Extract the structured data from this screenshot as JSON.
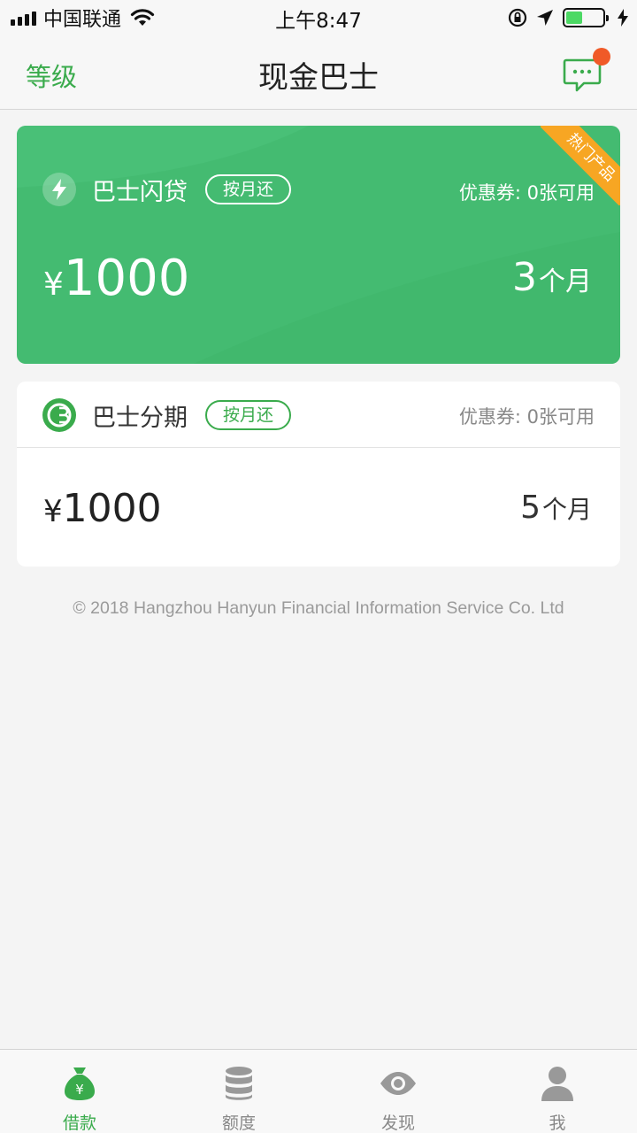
{
  "status_bar": {
    "carrier": "中国联通",
    "time": "上午8:47",
    "battery_level": 0.45
  },
  "nav": {
    "left_label": "等级",
    "title": "现金巴士",
    "message_icon": "chat-bubble-icon",
    "has_unread": true
  },
  "products": [
    {
      "name": "巴士闪贷",
      "icon": "lightning-icon",
      "tag": "按月还",
      "coupon": "优惠券: 0张可用",
      "currency": "¥",
      "amount": "1000",
      "term_value": "3",
      "term_unit": "个月",
      "badge": "热门产品"
    },
    {
      "name": "巴士分期",
      "icon": "installment-logo-icon",
      "tag": "按月还",
      "coupon": "优惠券: 0张可用",
      "currency": "¥",
      "amount": "1000",
      "term_value": "5",
      "term_unit": "个月"
    }
  ],
  "footer": {
    "copyright": "© 2018 Hangzhou Hanyun Financial Information Service Co. Ltd"
  },
  "tabs": [
    {
      "label": "借款",
      "icon": "money-bag-icon",
      "active": true
    },
    {
      "label": "额度",
      "icon": "database-icon",
      "active": false
    },
    {
      "label": "发现",
      "icon": "eye-icon",
      "active": false
    },
    {
      "label": "我",
      "icon": "user-icon",
      "active": false
    }
  ],
  "colors": {
    "accent": "#3aab4c",
    "card_green": "#44bb71",
    "badge_orange": "#f7a623",
    "notification": "#f05a28"
  }
}
